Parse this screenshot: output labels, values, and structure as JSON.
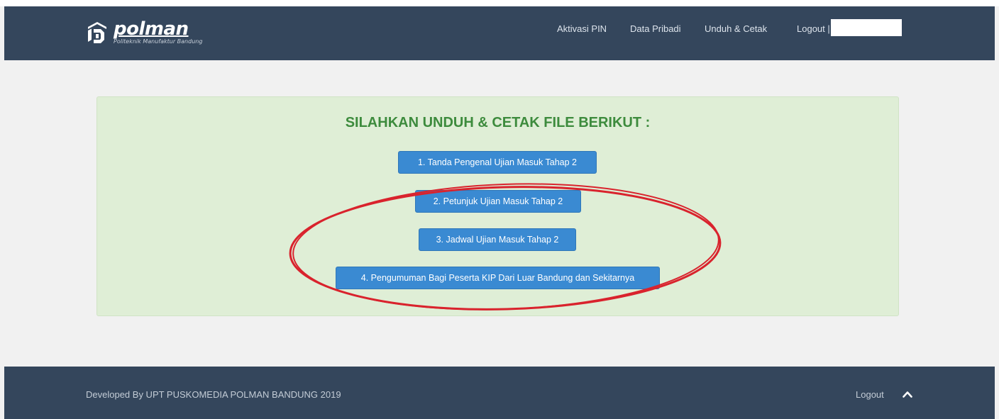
{
  "header": {
    "logo_word": "polman",
    "logo_subtitle": "Politeknik Manufaktur Bandung",
    "nav": {
      "aktivasi_pin": "Aktivasi PIN",
      "data_pribadi": "Data Pribadi",
      "unduh_cetak": "Unduh & Cetak",
      "logout": "Logout |"
    }
  },
  "panel": {
    "title": "SILAHKAN UNDUH & CETAK FILE BERIKUT :",
    "buttons": [
      "1. Tanda Pengenal Ujian Masuk Tahap 2",
      "2. Petunjuk Ujian Masuk Tahap 2",
      "3. Jadwal Ujian Masuk Tahap 2",
      "4. Pengumuman Bagi Peserta KIP Dari Luar Bandung dan Sekitarnya"
    ]
  },
  "footer": {
    "developed_by": "Developed By UPT PUSKOMEDIA POLMAN BANDUNG 2019",
    "logout": "Logout",
    "scroll_top_icon": "chevron-up-icon"
  },
  "colors": {
    "navbar": "#34465c",
    "panel_bg": "#dfeed6",
    "title_green": "#3d8b3d",
    "button_blue": "#3a8ad2",
    "annotation_red": "#d9232d"
  }
}
